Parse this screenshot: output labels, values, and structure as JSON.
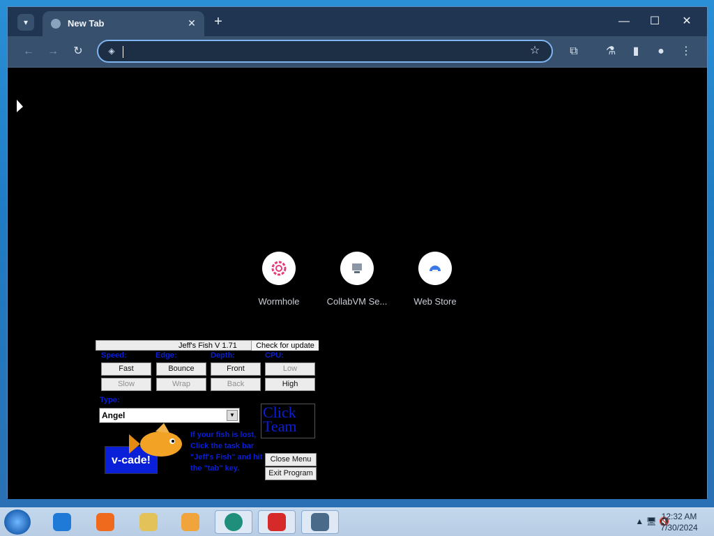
{
  "browser": {
    "tab": {
      "title": "New Tab"
    },
    "omnibox": {
      "value": "",
      "placeholder": ""
    }
  },
  "shortcuts": [
    {
      "label": "Wormhole",
      "icon": "wormhole-icon"
    },
    {
      "label": "CollabVM Se...",
      "icon": "collabvm-icon"
    },
    {
      "label": "Web Store",
      "icon": "webstore-icon"
    }
  ],
  "jeffs_fish": {
    "title": "Jeff's Fish V 1.71",
    "update_label": "Check for update",
    "headers": {
      "speed": "Speed:",
      "edge": "Edge:",
      "depth": "Depth:",
      "cpu": "CPU:"
    },
    "buttons": {
      "fast": "Fast",
      "slow": "Slow",
      "bounce": "Bounce",
      "wrap": "Wrap",
      "front": "Front",
      "back": "Back",
      "low": "Low",
      "high": "High",
      "close_menu": "Close Menu",
      "exit_program": "Exit Program"
    },
    "type_label": "Type:",
    "type_value": "Angel",
    "clickteam_text": "Click Team",
    "vcade_text": "v-cade!",
    "message": "If your fish is lost, Click the task bar \"Jeff's Fish\" and hit the \"tab\" key."
  },
  "taskbar": {
    "time": "12:32 AM",
    "date": "7/30/2024"
  }
}
